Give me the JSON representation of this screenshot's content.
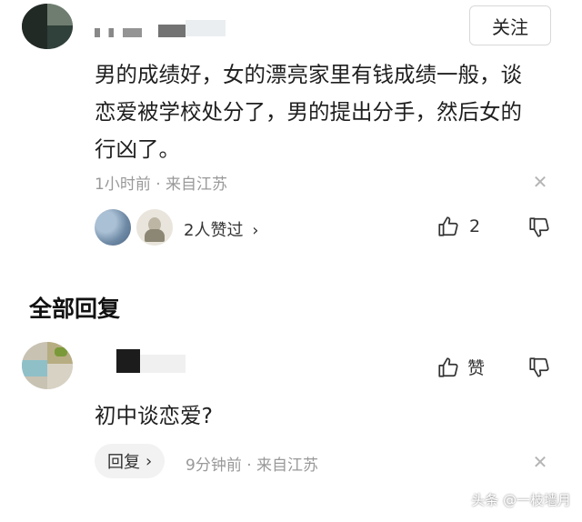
{
  "comment": {
    "follow_label": "关注",
    "text": "男的成绩好，女的漂亮家里有钱成绩一般，谈恋爱被学校处分了，男的提出分手，然后女的行凶了。",
    "meta": "1小时前 · 来自江苏",
    "likers_text": "2人赞过",
    "like_count": "2"
  },
  "replies_section": {
    "title": "全部回复"
  },
  "reply": {
    "like_label": "赞",
    "text": "初中谈恋爱?",
    "reply_label": "回复",
    "meta": "9分钟前 · 来自江苏"
  },
  "watermark": "头条 @一枝墙月",
  "icons": {
    "close": "close-icon",
    "thumbs_up": "thumbs-up-icon",
    "thumbs_down": "thumbs-down-icon",
    "chevron": "chevron-right-icon"
  }
}
